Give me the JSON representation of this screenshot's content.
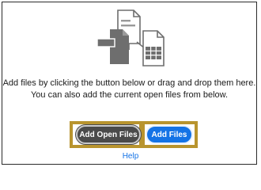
{
  "dropzone": {
    "illustration_icon": "file-documents-icon",
    "line1": "Add files by clicking the button below or drag and drop them here.",
    "line2": "You can also add the current open files from below."
  },
  "buttons": {
    "add_open_files": "Add Open Files",
    "add_files": "Add Files"
  },
  "help_link": "Help",
  "colors": {
    "accent_blue": "#1473e6",
    "dark_button": "#4a4a4a",
    "highlight_gold": "#b8942e",
    "icon_gray": "#6e6e6e"
  }
}
